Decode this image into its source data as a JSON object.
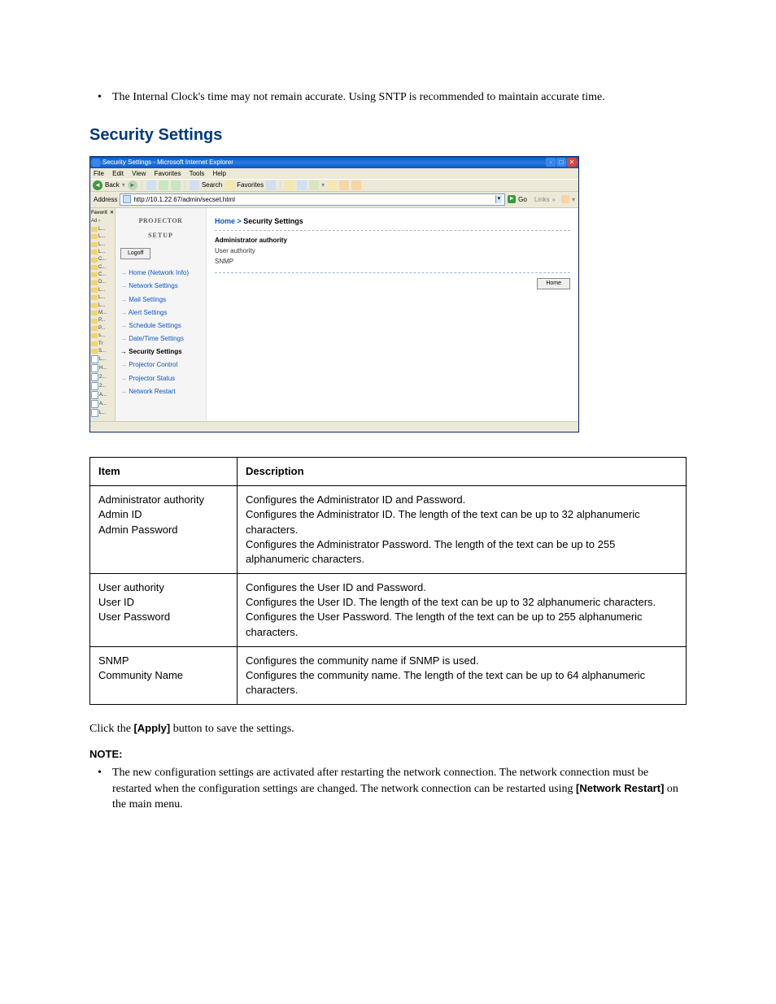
{
  "intro_bullet": "The Internal Clock's time may not remain accurate. Using SNTP is recommended to maintain accurate time.",
  "section_heading": "Security Settings",
  "ie": {
    "title": "Security Settings - Microsoft Internet Explorer",
    "menus": {
      "file": "File",
      "edit": "Edit",
      "view": "View",
      "favorites": "Favorites",
      "tools": "Tools",
      "help": "Help"
    },
    "toolbar": {
      "back": "Back",
      "search": "Search",
      "favorites": "Favorites"
    },
    "address_label": "Address",
    "address_value": "http://10.1.22.67/admin/secset.html",
    "go": "Go",
    "links": "Links",
    "fav_header": "Favorit",
    "fav_add": "Ad",
    "fav_items": [
      "L...",
      "L...",
      "L...",
      "L...",
      "C...",
      "C...",
      "C...",
      "D...",
      "L...",
      "L...",
      "L...",
      "M...",
      "P...",
      "P...",
      "s...",
      "Tr",
      "S...",
      "L...",
      "H...",
      "2...",
      "2...",
      "A...",
      "A...",
      "L..."
    ],
    "side": {
      "logo_top": "PROJECTOR",
      "logo_mid": "· · · · · · · · · · · ·",
      "logo_bot": "SETUP",
      "logoff": "Logoff",
      "nav": [
        {
          "label": "Home (Network Info)",
          "bold": false
        },
        {
          "label": "Network Settings",
          "bold": false
        },
        {
          "label": "Mail Settings",
          "bold": false
        },
        {
          "label": "Alert Settings",
          "bold": false
        },
        {
          "label": "Schedule Settings",
          "bold": false
        },
        {
          "label": "Date/Time Settings",
          "bold": false
        },
        {
          "label": "Security Settings",
          "bold": true
        },
        {
          "label": "Projector Control",
          "bold": false
        },
        {
          "label": "Projector Status",
          "bold": false
        },
        {
          "label": "Network Restart",
          "bold": false
        }
      ]
    },
    "main": {
      "bc_home": "Home",
      "bc_sep": " > ",
      "bc_current": "Security Settings",
      "rows": [
        "Administrator authority",
        "User authority",
        "SNMP"
      ],
      "home_btn": "Home"
    }
  },
  "table": {
    "head_item": "Item",
    "head_desc": "Description",
    "rows": [
      {
        "item_lines": [
          "Administrator authority",
          "Admin ID",
          "Admin Password"
        ],
        "desc": "Configures the Administrator ID and Password.\nConfigures the Administrator ID. The length of the text can be up to 32 alphanumeric characters.\nConfigures the Administrator Password. The length of the text can be up to 255 alphanumeric characters."
      },
      {
        "item_lines": [
          "User authority",
          "User ID",
          "User Password"
        ],
        "desc": "Configures the User ID and Password.\nConfigures the User ID. The length of the text can be up to 32 alphanumeric characters.\nConfigures the User Password. The length of the text can be up to 255 alphanumeric characters."
      },
      {
        "item_lines": [
          "SNMP",
          "Community Name"
        ],
        "desc": "Configures the community name if SNMP is used.\nConfigures the community name. The length of the text can be up to 64 alphanumeric characters."
      }
    ]
  },
  "post_click_1": "Click the ",
  "post_click_btn": "[Apply]",
  "post_click_2": " button to save the settings.",
  "note_label": "NOTE:",
  "note_bullet_1": "The new configuration settings are activated after restarting the network connection. The network connection must be restarted when the configuration settings are changed. The network connection can be restarted using ",
  "note_bullet_bold": "[Network Restart]",
  "note_bullet_2": " on the main menu."
}
